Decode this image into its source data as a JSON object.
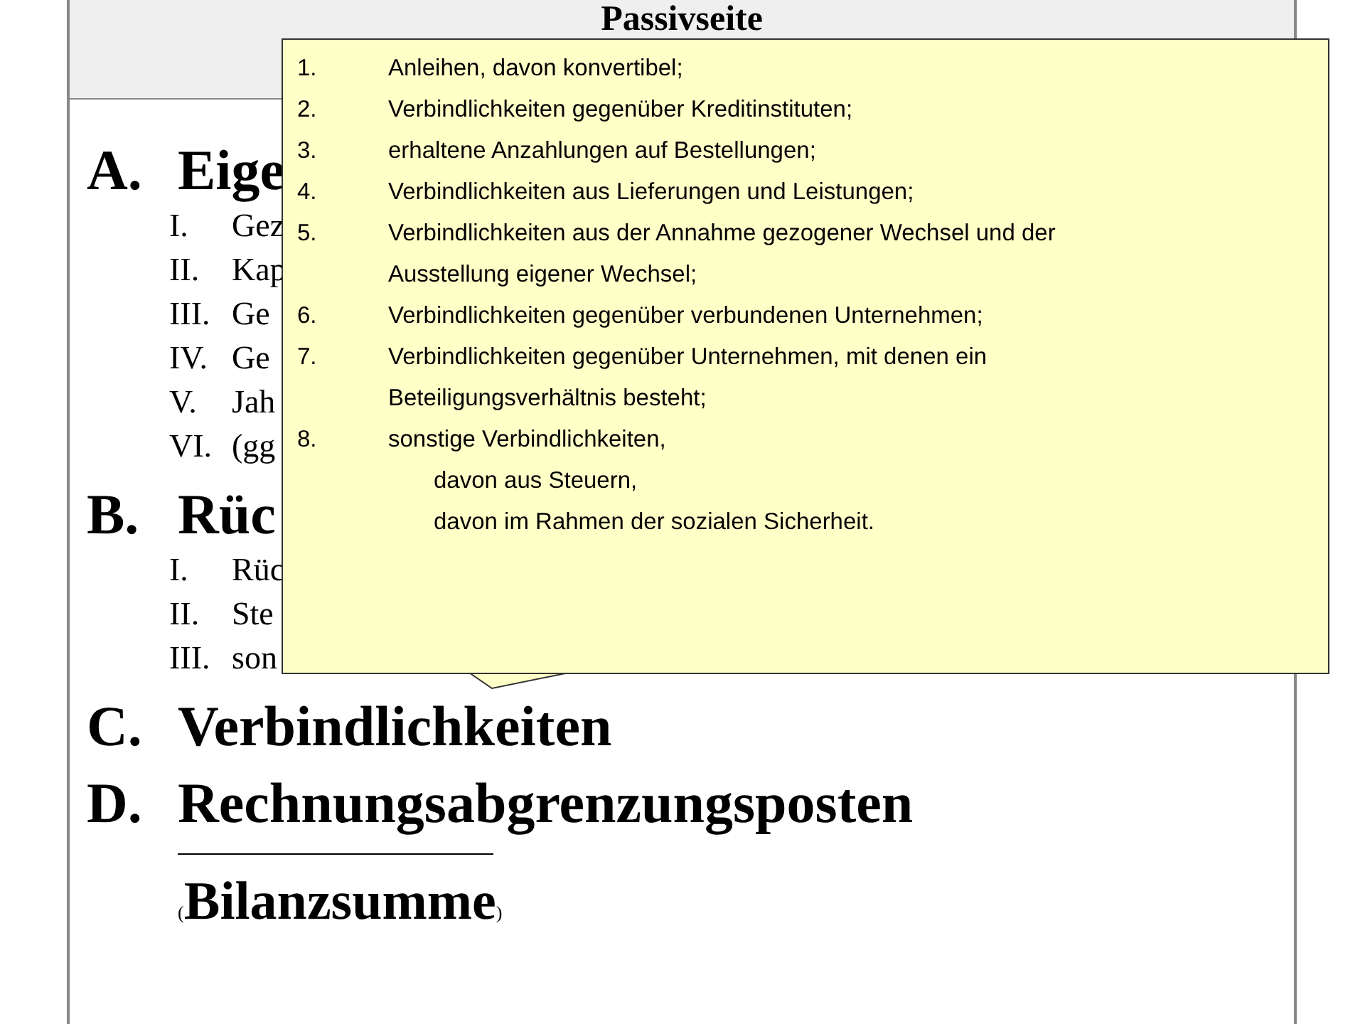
{
  "slide": {
    "title": "Passivseite",
    "sections": [
      {
        "letter": "A.",
        "label": "Eige",
        "items": [
          {
            "numeral": "I.",
            "text": "Gez"
          },
          {
            "numeral": "II.",
            "text": "Kap"
          },
          {
            "numeral": "III.",
            "text": "Ge"
          },
          {
            "numeral": "IV.",
            "text": "Ge"
          },
          {
            "numeral": "V.",
            "text": "Jah"
          },
          {
            "numeral": "VI.",
            "text": "(gg"
          }
        ]
      },
      {
        "letter": "B.",
        "label": "Rüc",
        "items": [
          {
            "numeral": "I.",
            "text": "Rüc"
          },
          {
            "numeral": "II.",
            "text": "Ste"
          },
          {
            "numeral": "III.",
            "text": "son"
          }
        ]
      },
      {
        "letter": "C.",
        "label": "Verbindlichkeiten"
      },
      {
        "letter": "D.",
        "label": "Rechnungsabgrenzungsposten"
      }
    ],
    "total": {
      "open": "(",
      "label": "Bilanzsumme",
      "close": ")"
    }
  },
  "callout": {
    "items": [
      {
        "number": "1.",
        "lines": [
          "Anleihen, davon konvertibel;"
        ]
      },
      {
        "number": "2.",
        "lines": [
          "Verbindlichkeiten gegenüber Kreditinstituten;"
        ]
      },
      {
        "number": "3.",
        "lines": [
          "erhaltene Anzahlungen auf Bestellungen;"
        ]
      },
      {
        "number": "4.",
        "lines": [
          "Verbindlichkeiten aus Lieferungen und Leistungen;"
        ]
      },
      {
        "number": "5.",
        "lines": [
          "Verbindlichkeiten aus der Annahme gezogener Wechsel und der",
          "Ausstellung eigener Wechsel;"
        ]
      },
      {
        "number": "6.",
        "lines": [
          "Verbindlichkeiten gegenüber verbundenen Unternehmen;"
        ]
      },
      {
        "number": "7.",
        "lines": [
          "Verbindlichkeiten gegenüber Unternehmen, mit denen ein",
          "Beteiligungsverhältnis besteht;"
        ]
      },
      {
        "number": "8.",
        "lines": [
          "sonstige Verbindlichkeiten,"
        ],
        "children": [
          "davon aus Steuern,",
          "davon im Rahmen der sozialen Sicherheit."
        ]
      }
    ]
  }
}
